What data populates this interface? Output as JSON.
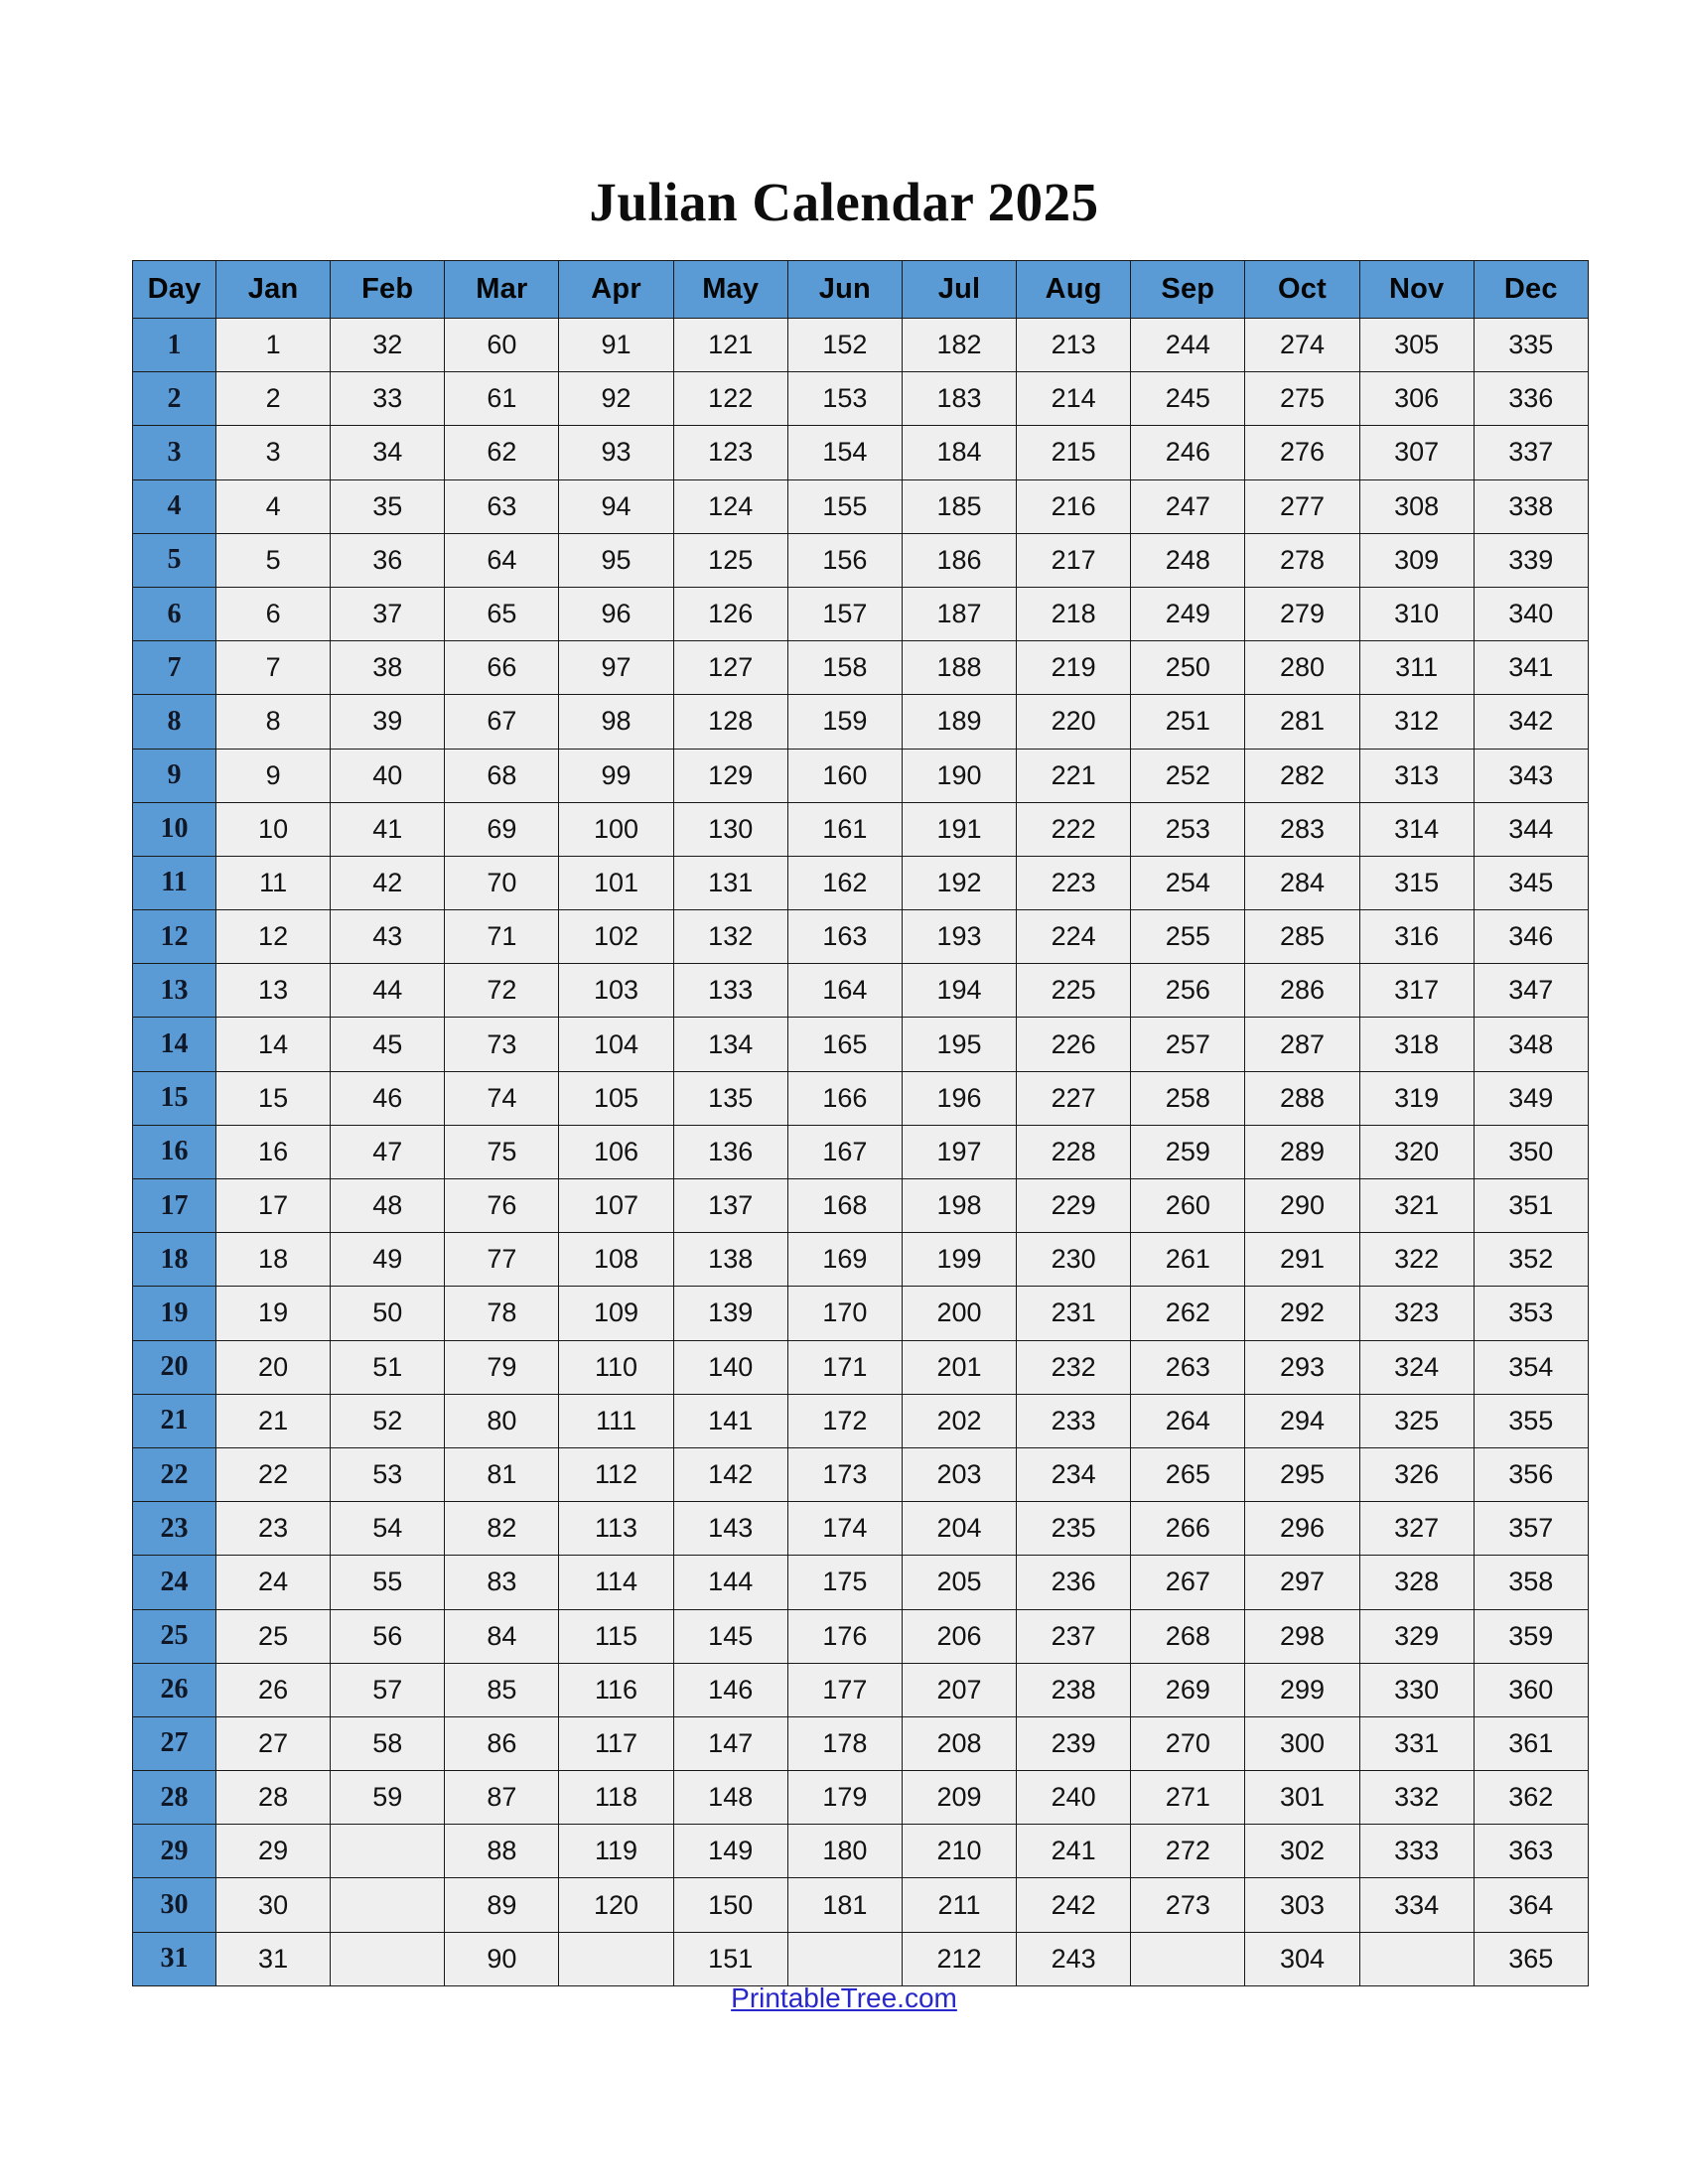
{
  "title": "Julian Calendar 2025",
  "colors": {
    "header_blue": "#5B9BD5",
    "cell_gray": "#EFEFEF",
    "border": "#1A1A1A",
    "link_blue": "#2727CC",
    "text": "#111111"
  },
  "footer": {
    "link_label": "PrintableTree.com"
  },
  "table": {
    "columns": [
      "Day",
      "Jan",
      "Feb",
      "Mar",
      "Apr",
      "May",
      "Jun",
      "Jul",
      "Aug",
      "Sep",
      "Oct",
      "Nov",
      "Dec"
    ],
    "day_label": "Day",
    "months": [
      "Jan",
      "Feb",
      "Mar",
      "Apr",
      "May",
      "Jun",
      "Jul",
      "Aug",
      "Sep",
      "Oct",
      "Nov",
      "Dec"
    ],
    "rows": [
      {
        "day": "1",
        "values": [
          "1",
          "32",
          "60",
          "91",
          "121",
          "152",
          "182",
          "213",
          "244",
          "274",
          "305",
          "335"
        ]
      },
      {
        "day": "2",
        "values": [
          "2",
          "33",
          "61",
          "92",
          "122",
          "153",
          "183",
          "214",
          "245",
          "275",
          "306",
          "336"
        ]
      },
      {
        "day": "3",
        "values": [
          "3",
          "34",
          "62",
          "93",
          "123",
          "154",
          "184",
          "215",
          "246",
          "276",
          "307",
          "337"
        ]
      },
      {
        "day": "4",
        "values": [
          "4",
          "35",
          "63",
          "94",
          "124",
          "155",
          "185",
          "216",
          "247",
          "277",
          "308",
          "338"
        ]
      },
      {
        "day": "5",
        "values": [
          "5",
          "36",
          "64",
          "95",
          "125",
          "156",
          "186",
          "217",
          "248",
          "278",
          "309",
          "339"
        ]
      },
      {
        "day": "6",
        "values": [
          "6",
          "37",
          "65",
          "96",
          "126",
          "157",
          "187",
          "218",
          "249",
          "279",
          "310",
          "340"
        ]
      },
      {
        "day": "7",
        "values": [
          "7",
          "38",
          "66",
          "97",
          "127",
          "158",
          "188",
          "219",
          "250",
          "280",
          "311",
          "341"
        ]
      },
      {
        "day": "8",
        "values": [
          "8",
          "39",
          "67",
          "98",
          "128",
          "159",
          "189",
          "220",
          "251",
          "281",
          "312",
          "342"
        ]
      },
      {
        "day": "9",
        "values": [
          "9",
          "40",
          "68",
          "99",
          "129",
          "160",
          "190",
          "221",
          "252",
          "282",
          "313",
          "343"
        ]
      },
      {
        "day": "10",
        "values": [
          "10",
          "41",
          "69",
          "100",
          "130",
          "161",
          "191",
          "222",
          "253",
          "283",
          "314",
          "344"
        ]
      },
      {
        "day": "11",
        "values": [
          "11",
          "42",
          "70",
          "101",
          "131",
          "162",
          "192",
          "223",
          "254",
          "284",
          "315",
          "345"
        ]
      },
      {
        "day": "12",
        "values": [
          "12",
          "43",
          "71",
          "102",
          "132",
          "163",
          "193",
          "224",
          "255",
          "285",
          "316",
          "346"
        ]
      },
      {
        "day": "13",
        "values": [
          "13",
          "44",
          "72",
          "103",
          "133",
          "164",
          "194",
          "225",
          "256",
          "286",
          "317",
          "347"
        ]
      },
      {
        "day": "14",
        "values": [
          "14",
          "45",
          "73",
          "104",
          "134",
          "165",
          "195",
          "226",
          "257",
          "287",
          "318",
          "348"
        ]
      },
      {
        "day": "15",
        "values": [
          "15",
          "46",
          "74",
          "105",
          "135",
          "166",
          "196",
          "227",
          "258",
          "288",
          "319",
          "349"
        ]
      },
      {
        "day": "16",
        "values": [
          "16",
          "47",
          "75",
          "106",
          "136",
          "167",
          "197",
          "228",
          "259",
          "289",
          "320",
          "350"
        ]
      },
      {
        "day": "17",
        "values": [
          "17",
          "48",
          "76",
          "107",
          "137",
          "168",
          "198",
          "229",
          "260",
          "290",
          "321",
          "351"
        ]
      },
      {
        "day": "18",
        "values": [
          "18",
          "49",
          "77",
          "108",
          "138",
          "169",
          "199",
          "230",
          "261",
          "291",
          "322",
          "352"
        ]
      },
      {
        "day": "19",
        "values": [
          "19",
          "50",
          "78",
          "109",
          "139",
          "170",
          "200",
          "231",
          "262",
          "292",
          "323",
          "353"
        ]
      },
      {
        "day": "20",
        "values": [
          "20",
          "51",
          "79",
          "110",
          "140",
          "171",
          "201",
          "232",
          "263",
          "293",
          "324",
          "354"
        ]
      },
      {
        "day": "21",
        "values": [
          "21",
          "52",
          "80",
          "111",
          "141",
          "172",
          "202",
          "233",
          "264",
          "294",
          "325",
          "355"
        ]
      },
      {
        "day": "22",
        "values": [
          "22",
          "53",
          "81",
          "112",
          "142",
          "173",
          "203",
          "234",
          "265",
          "295",
          "326",
          "356"
        ]
      },
      {
        "day": "23",
        "values": [
          "23",
          "54",
          "82",
          "113",
          "143",
          "174",
          "204",
          "235",
          "266",
          "296",
          "327",
          "357"
        ]
      },
      {
        "day": "24",
        "values": [
          "24",
          "55",
          "83",
          "114",
          "144",
          "175",
          "205",
          "236",
          "267",
          "297",
          "328",
          "358"
        ]
      },
      {
        "day": "25",
        "values": [
          "25",
          "56",
          "84",
          "115",
          "145",
          "176",
          "206",
          "237",
          "268",
          "298",
          "329",
          "359"
        ]
      },
      {
        "day": "26",
        "values": [
          "26",
          "57",
          "85",
          "116",
          "146",
          "177",
          "207",
          "238",
          "269",
          "299",
          "330",
          "360"
        ]
      },
      {
        "day": "27",
        "values": [
          "27",
          "58",
          "86",
          "117",
          "147",
          "178",
          "208",
          "239",
          "270",
          "300",
          "331",
          "361"
        ]
      },
      {
        "day": "28",
        "values": [
          "28",
          "59",
          "87",
          "118",
          "148",
          "179",
          "209",
          "240",
          "271",
          "301",
          "332",
          "362"
        ]
      },
      {
        "day": "29",
        "values": [
          "29",
          "",
          "88",
          "119",
          "149",
          "180",
          "210",
          "241",
          "272",
          "302",
          "333",
          "363"
        ]
      },
      {
        "day": "30",
        "values": [
          "30",
          "",
          "89",
          "120",
          "150",
          "181",
          "211",
          "242",
          "273",
          "303",
          "334",
          "364"
        ]
      },
      {
        "day": "31",
        "values": [
          "31",
          "",
          "90",
          "",
          "151",
          "",
          "212",
          "243",
          "",
          "304",
          "",
          "365"
        ]
      }
    ]
  }
}
